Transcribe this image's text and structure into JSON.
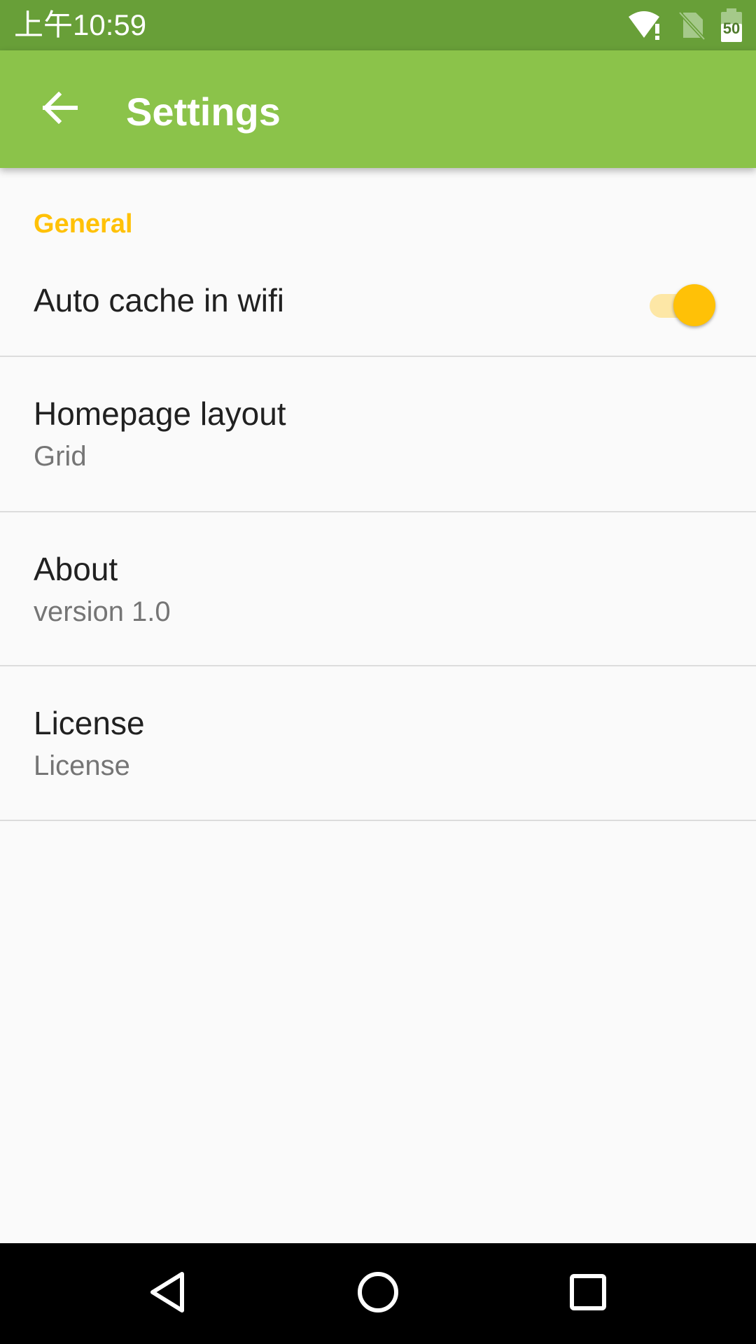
{
  "status_bar": {
    "time": "上午10:59",
    "icons": [
      "wifi-alert-icon",
      "no-sim-icon",
      "battery-icon"
    ],
    "battery_level": "50"
  },
  "app_bar": {
    "title": "Settings",
    "back_icon": "arrow-back-icon"
  },
  "preferences": {
    "section_header": "General",
    "auto_cache": {
      "title": "Auto cache in wifi",
      "enabled": true
    },
    "homepage_layout": {
      "title": "Homepage layout",
      "summary": "Grid"
    },
    "about": {
      "title": "About",
      "summary": "version 1.0"
    },
    "license": {
      "title": "License",
      "summary": "License"
    }
  },
  "nav_bar": {
    "icons": [
      "nav-back-icon",
      "nav-home-icon",
      "nav-recents-icon"
    ]
  },
  "colors": {
    "status_bar": "#689f38",
    "app_bar": "#8bc34a",
    "accent": "#ffc107",
    "background": "#fafafa"
  }
}
